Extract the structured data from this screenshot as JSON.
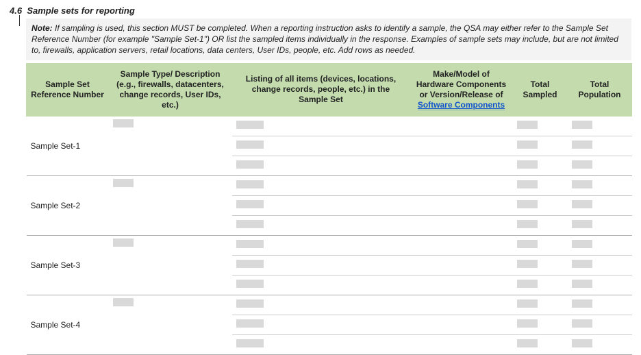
{
  "section": {
    "number": "4.6",
    "title": "Sample sets for reporting"
  },
  "note": {
    "label": "Note:",
    "text": "If sampling is used, this section MUST be completed. When a reporting instruction asks to identify a sample, the QSA may either refer to the Sample Set Reference Number (for example \"Sample Set-1\") OR list the sampled items individually in the response. Examples of sample sets may include, but are not limited to, firewalls, application servers, retail locations, data centers, User IDs, people, etc. Add rows as needed."
  },
  "table": {
    "headers": {
      "col1": "Sample Set Reference Number",
      "col2": "Sample Type/ Description (e.g., firewalls, datacenters, change records, User IDs, etc.)",
      "col3": "Listing of all items (devices, locations, change records, people, etc.) in the Sample Set",
      "col4_prefix": "Make/Model of Hardware Components or Version/Release of ",
      "col4_link": "Software Components",
      "col5": "Total Sampled",
      "col6": "Total Population"
    },
    "rows": [
      {
        "ref": "Sample Set-1"
      },
      {
        "ref": "Sample Set-2"
      },
      {
        "ref": "Sample Set-3"
      },
      {
        "ref": "Sample Set-4"
      }
    ]
  }
}
